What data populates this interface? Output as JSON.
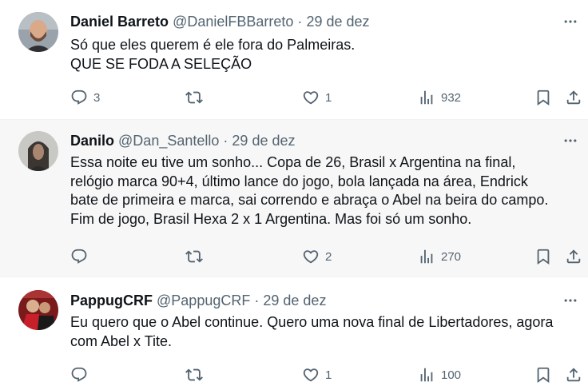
{
  "tweets": [
    {
      "name": "Daniel Barreto",
      "handle": "@DanielFBBarreto",
      "separator": "·",
      "date": "29 de dez",
      "lines": [
        "Só que eles querem é ele fora do Palmeiras.",
        "QUE SE FODA A SELEÇÃO"
      ],
      "replies": "3",
      "retweets": "",
      "likes": "1",
      "views": "932"
    },
    {
      "name": "Danilo",
      "handle": "@Dan_Santello",
      "separator": "·",
      "date": "29 de dez",
      "lines": [
        "Essa noite eu tive um sonho... Copa de 26, Brasil x Argentina na final,",
        "relógio marca 90+4, último lance do jogo, bola lançada na área, Endrick",
        "bate de primeira e marca, sai correndo e abraça o Abel na beira do campo.",
        "Fim de jogo, Brasil Hexa 2 x 1 Argentina. Mas foi só um sonho."
      ],
      "replies": "",
      "retweets": "",
      "likes": "2",
      "views": "270"
    },
    {
      "name": "PappugCRF",
      "handle": "@PappugCRF",
      "separator": "·",
      "date": "29 de dez",
      "lines": [
        "Eu quero que o Abel continue. Quero uma nova final de Libertadores, agora",
        "com Abel x Tite."
      ],
      "replies": "",
      "retweets": "",
      "likes": "1",
      "views": "100"
    }
  ],
  "icons": {
    "more": "more-horizontal-icon",
    "reply": "reply-icon",
    "retweet": "retweet-icon",
    "like": "heart-icon",
    "views": "views-chart-icon",
    "bookmark": "bookmark-icon",
    "share": "share-icon"
  },
  "colors": {
    "text": "#0f1419",
    "secondary": "#536471",
    "highlight_bg": "#f7f7f7"
  }
}
